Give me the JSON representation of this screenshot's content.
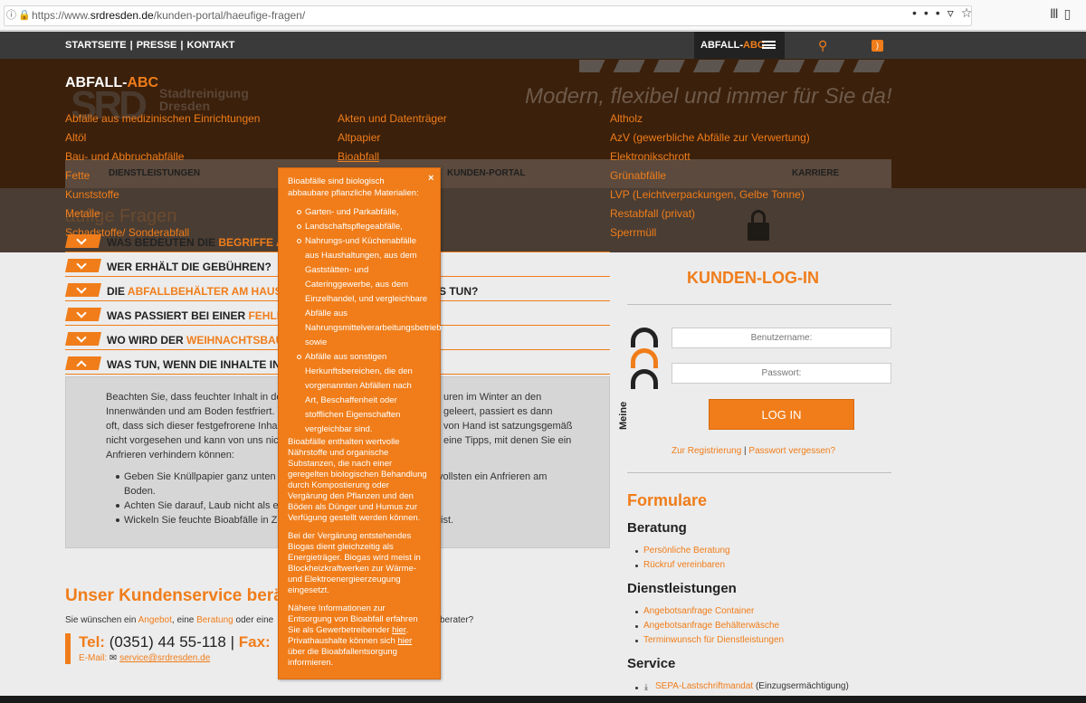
{
  "browser": {
    "url_prefix": "https://www.",
    "url_domain": "srdresden.de",
    "url_path": "/kunden-portal/haeufige-fragen/",
    "info_icon": "info-icon",
    "actions_icon": "•••"
  },
  "topnav": {
    "links": [
      "STARTSEITE",
      "PRESSE",
      "KONTAKT"
    ],
    "abc_label_a": "ABFALL-",
    "abc_label_b": "ABC"
  },
  "header": {
    "slogan": "Modern, flexibel und immer für Sie da!",
    "logo_line1": "Stadtreinigung",
    "logo_line2": "Dresden",
    "logo_mark": "SRD",
    "subnav": [
      "DIENSTLEISTUNGEN",
      "KUNDEN-PORTAL",
      "KARRIERE"
    ],
    "faq_title_partial": "äufige Fragen"
  },
  "abc_menu": {
    "title_a": "ABFALL-",
    "title_b": "ABC",
    "col1": [
      "Abfälle aus medizinischen Einrichtungen",
      "Altöl",
      "Bau- und Abbruchabfälle",
      "Fette",
      "Kunststoffe",
      "Metalle",
      "Schadstoffe/ Sonderabfall"
    ],
    "col2": [
      "Akten und Datenträger",
      "Altpapier",
      "Bioabfall"
    ],
    "col3": [
      "Altholz",
      "AzV (gewerbliche Abfälle zur Verwertung)",
      "Elektronikschrott",
      "Grünabfälle",
      "LVP (Leichtverpackungen, Gelbe Tonne)",
      "Restabfall (privat)",
      "Sperrmüll"
    ]
  },
  "faq": {
    "rows": [
      {
        "a": "WAS BEDEUTEN DIE ",
        "b": "BEGRIFFE AU",
        "c": ""
      },
      {
        "a": "WER ERHÄLT DIE GEBÜHREN?",
        "b": "",
        "c": ""
      },
      {
        "a": "DIE ",
        "b": "ABFALLBEHÄLTER AM HAUS",
        "c": " V",
        "tail": "S TUN?"
      },
      {
        "a": "WAS PASSIERT BEI EINER ",
        "b": "FEHLBE",
        "c": ""
      },
      {
        "a": "WO WIRD DER ",
        "b": "WEIHNACHTSBAU",
        "c": ""
      },
      {
        "a": "WAS TUN, WENN DIE INHALTE IN",
        "b": "",
        "c": ""
      }
    ],
    "panel_lines_left": [
      "Beachten Sie, dass feuchter Inhalt in der T",
      "Innenwänden und am Boden festfriert. W",
      "oft, dass sich dieser festgefrorene Inhalt n",
      "nicht vorgesehen und kann von uns nicht",
      "Anfrieren verhindern können:"
    ],
    "panel_lines_right": [
      "uren im Winter an den",
      "geleert, passiert es dann",
      "von Hand ist satzungsgemäß",
      "eine Tipps, mit denen Sie ein"
    ],
    "bullets_left": [
      "Geben Sie Knüllpapier ganz unten in",
      "Boden.",
      "Achten Sie darauf, Laub nicht als erste",
      "Wickeln Sie feuchte Bioabfälle in Zeit"
    ],
    "bullets_right": [
      "vollsten ein Anfrieren am",
      "",
      "",
      "ist."
    ]
  },
  "kundenservice": {
    "title": "Unser Kundenservice berä",
    "line_a": "Sie wünschen ein ",
    "line_b": "Angebot",
    "line_c": ", eine ",
    "line_d": "Beratung",
    "line_e": " oder eine",
    "line_tail": "berater?",
    "tel_label": "Tel:",
    "tel_number": " (0351) 44 55-118 | ",
    "fax_label": "Fax:",
    "email_label": "E-Mail: ",
    "email_addr": "service@srdresden.de"
  },
  "login": {
    "title": "KUNDEN-LOG-IN",
    "meine": "Meine",
    "username_placeholder": "Benutzername:",
    "password_placeholder": "Passwort:",
    "button": "LOG IN",
    "register": "Zur Registrierung",
    "sep": " | ",
    "forgot": "Passwort vergessen?"
  },
  "sidebar": {
    "formulare": "Formulare",
    "beratung": "Beratung",
    "beratung_links": [
      "Persönliche Beratung",
      "Rückruf vereinbaren"
    ],
    "dienstleistungen": "Dienstleistungen",
    "dienst_links": [
      "Angebotsanfrage Container",
      "Angebotsanfrage Behälterwäsche",
      "Terminwunsch für Dienstleistungen"
    ],
    "service": "Service",
    "sepa_link": "SEPA-Lastschriftmandat",
    "sepa_text": " (Einzugsermächtigung)"
  },
  "popup": {
    "intro": [
      "Bioabfälle sind biologisch",
      "abbaubare pflanzliche Materialien:"
    ],
    "items": [
      [
        "Garten- und Parkabfälle,"
      ],
      [
        "Landschaftspflegeabfälle,"
      ],
      [
        "Nahrungs-und Küchenabfälle",
        "aus Haushaltungen, aus dem",
        "Gaststätten- und",
        "Cateringgewerbe, aus dem",
        "Einzelhandel, und vergleichbare",
        "Abfälle aus",
        "Nahrungsmittelverarbeitungsbetrieb",
        "sowie"
      ],
      [
        "Abfälle aus sonstigen",
        "Herkunftsbereichen, die den",
        "vorgenannten Abfällen  nach",
        "Art, Beschaffenheit oder",
        "stofflichen Eigenschaften",
        "vergleichbar sind."
      ]
    ],
    "para1": [
      "Bioabfälle enthalten wertvolle",
      "Nährstoffe und organische",
      "Substanzen, die nach einer",
      "geregelten biologischen Behandlung",
      "durch Kompostierung oder",
      "Vergärung den Pflanzen und den",
      "Böden als Dünger und Humus zur",
      "Verfügung gestellt werden können."
    ],
    "para2": [
      "Bei der Vergärung entstehendes",
      "Biogas dient gleichzeitig als",
      "Energieträger. Biogas wird meist in",
      "Blockheizkraftwerken zur Wärme-",
      "und Elektroenergieerzeugung",
      "eingesetzt."
    ],
    "para3_l1": "Nähere Informationen zur",
    "para3_l2": "Entsorgung von Bioabfall erfahren",
    "para3_l3a": "Sie als Gewerbetreibender ",
    "para3_l3b": "hier",
    "para3_l3c": ".",
    "para3_l4a": "Privathaushalte können sich ",
    "para3_l4b": "hier",
    "para3_l5": "über die Bioabfallentsorgung",
    "para3_l6": "informieren.",
    "close": "×"
  }
}
